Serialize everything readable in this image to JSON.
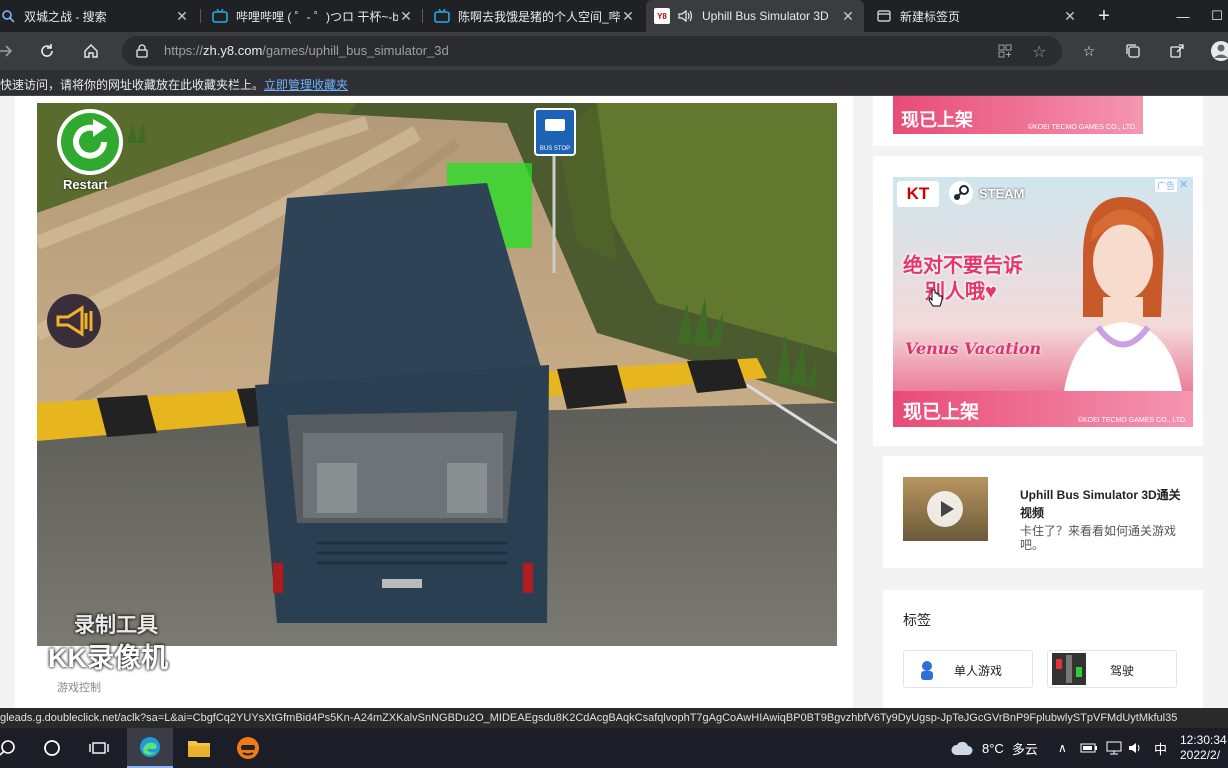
{
  "tabs": [
    {
      "title": "双城之战 - 搜索",
      "icon": "search-icon"
    },
    {
      "title": "哔哩哔哩 ( ゜- ゜)つロ 干杯~-b",
      "icon": "bilibili-icon"
    },
    {
      "title": "陈啊去我饿是猪的个人空间_哔",
      "icon": "bilibili-icon"
    },
    {
      "title": "Uphill Bus Simulator 3D",
      "icon": "y8-icon",
      "icon_text": "Y8",
      "active": true
    },
    {
      "title": "新建标签页",
      "icon": "newtab-icon"
    }
  ],
  "address": {
    "prefix": "https://",
    "host": "zh.y8.com",
    "path": "/games/uphill_bus_simulator_3d"
  },
  "favorites_bar": {
    "hint": "快速访问，请将你的网址收藏放在此收藏夹栏上。",
    "link": "立即管理收藏夹"
  },
  "game": {
    "restart_label": "Restart",
    "bus_stop_label": "BUS STOP",
    "caption": "游戏控制"
  },
  "watermark": {
    "line1": "录制工具",
    "line2": "KK录像机"
  },
  "ads": {
    "top_banner_text": "现已上架",
    "top_banner_copyright": "©KOEI TECMO GAMES CO., LTD.",
    "brand_kt": "KT",
    "brand_steam": "STEAM",
    "headline_line1": "绝对不要告诉",
    "headline_line2": "别人哦♥",
    "game_logo": "Venus Vacation",
    "bottom_text": "现已上架",
    "copyright": "©KOEI TECMO GAMES CO., LTD.",
    "ad_label": "广告"
  },
  "video": {
    "title": "Uphill Bus Simulator 3D通关视频",
    "description": "卡住了？来看看如何通关游戏吧。"
  },
  "tags": {
    "heading": "标签",
    "items": [
      {
        "label": "单人游戏"
      },
      {
        "label": "驾驶"
      }
    ]
  },
  "status_url": "gleads.g.doubleclick.net/aclk?sa=L&ai=CbgfCq2YUYsXtGfmBid4Ps5Kn-A24mZXKalvSnNGBDu2O_MIDEAEgsdu8K2CdAcgBAqkCsafqlvophT7gAgCoAwHIAwiqBP0BT9BgvzhbfV6Ty9DyUgsp-JpTeJGcGVrBnP9FplubwlySTpVFMdUytMkful35",
  "taskbar": {
    "weather_temp": "8°C",
    "weather_text": "多云",
    "ime": "中",
    "time": "12:30:34",
    "date": "2022/2/"
  },
  "colors": {
    "tab_bg": "#202124",
    "active_tab": "#3b3c3f",
    "ad_pink": "#e84b77",
    "link_blue": "#6fb3ff"
  }
}
